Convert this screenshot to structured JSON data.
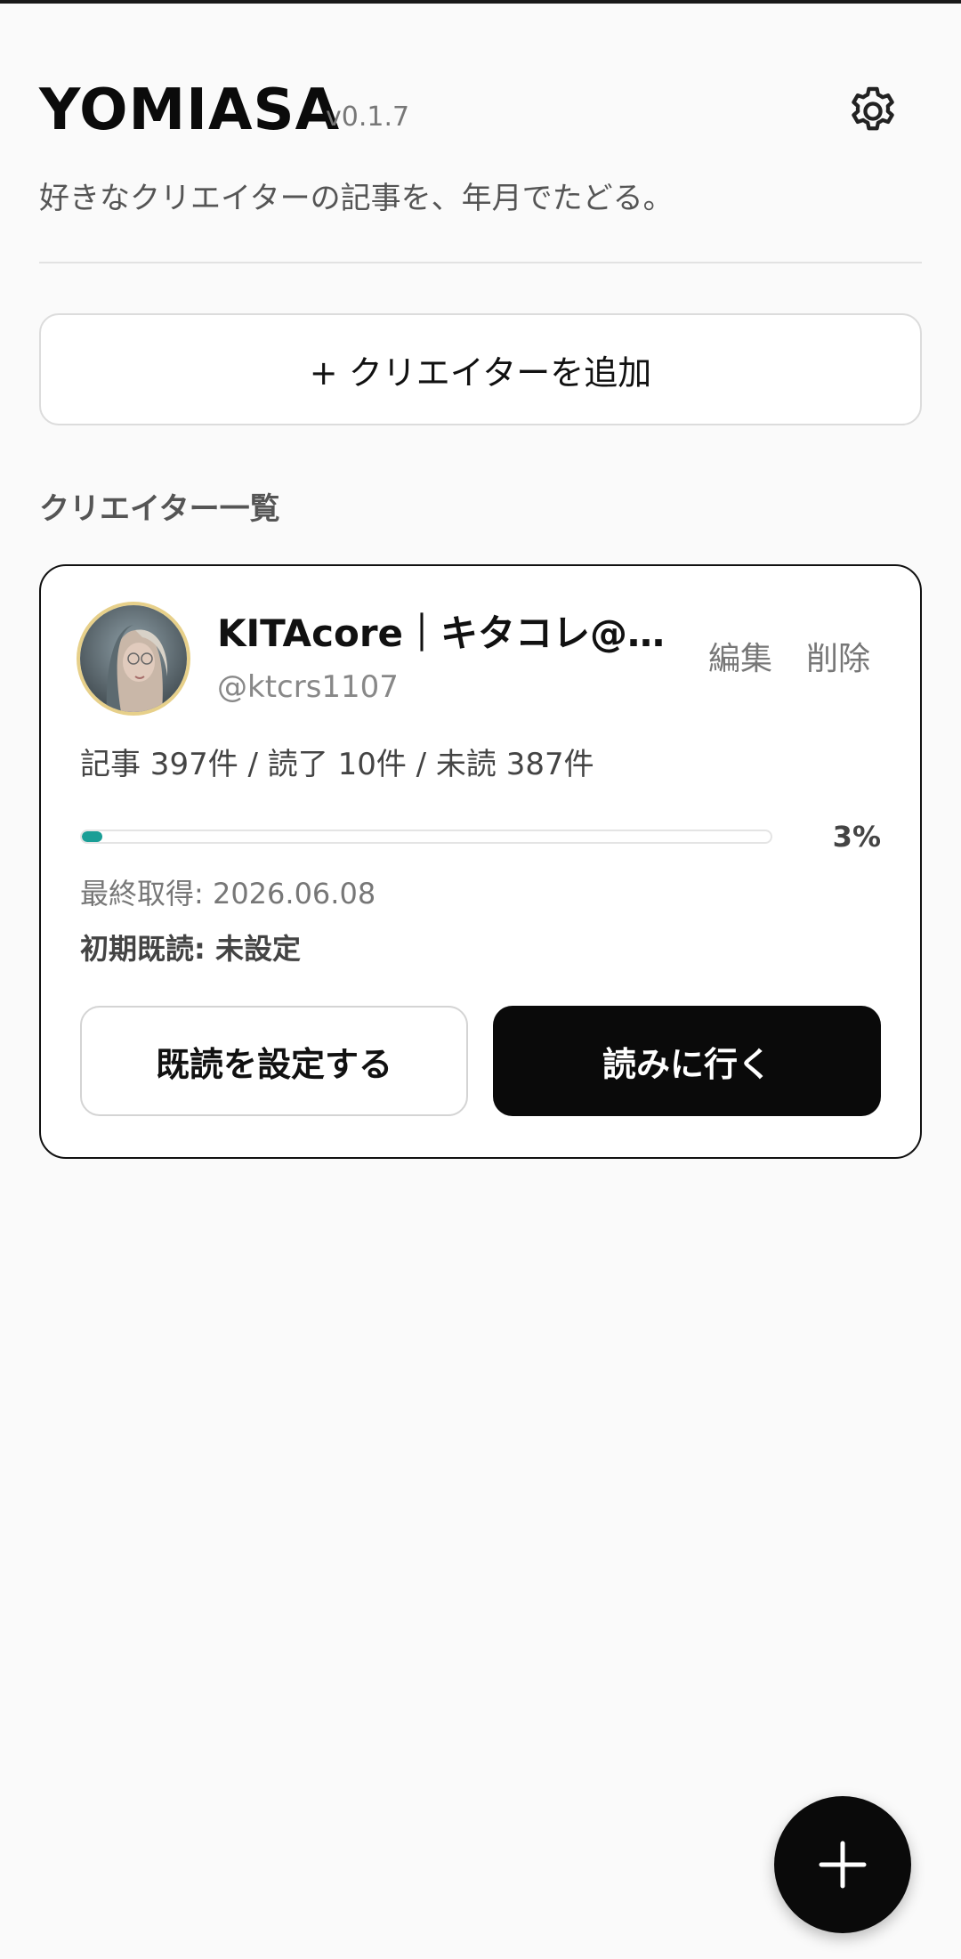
{
  "app": {
    "title": "YOMIASA",
    "version": "v0.1.7",
    "subtitle": "好きなクリエイターの記事を、年月でたどる。"
  },
  "actions": {
    "add_creator_label": "+ クリエイターを追加"
  },
  "section": {
    "title": "クリエイター一覧"
  },
  "creator": {
    "name": "KITAcore｜キタコレ@…",
    "handle": "@ktcrs1107",
    "edit_label": "編集",
    "delete_label": "削除",
    "stats": "記事 397件 / 読了 10件 / 未読 387件",
    "progress_percent": 3,
    "progress_label": "3%",
    "last_fetched": "最終取得: 2026.06.08",
    "initial_read": "初期既読: 未設定",
    "set_read_label": "既読を設定する",
    "go_read_label": "読みに行く"
  },
  "icons": {
    "settings": "gear-icon",
    "fab": "plus-icon"
  },
  "colors": {
    "accent": "#1a9e96",
    "primary_button": "#0a0a0a",
    "avatar_ring": "#e7d08a"
  }
}
